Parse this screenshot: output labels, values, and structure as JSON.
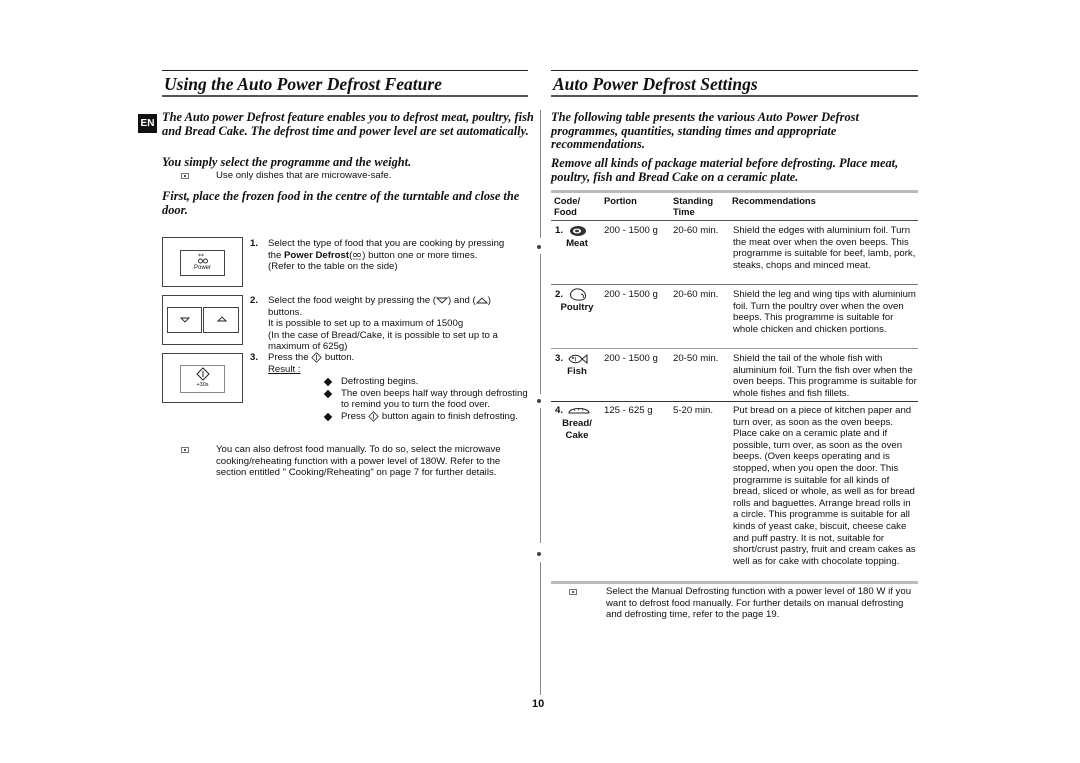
{
  "language_badge": "EN",
  "page_number": "10",
  "left": {
    "title": "Using the Auto Power Defrost Feature",
    "intro": "The Auto power Defrost feature enables you to defrost meat, poultry, fish and Bread Cake. The defrost time and power level are set automatically.",
    "subintro": "You simply select the programme and the weight.",
    "note1": "Use only dishes that are microwave-safe.",
    "first_place": "First, place the frozen food in the centre of the turntable and close the door.",
    "panels": {
      "power_label": "Power",
      "start_label": "+30s",
      "down_icon": "triangle-down-icon",
      "up_icon": "triangle-up-icon",
      "power_icon": "power-defrost-icon",
      "start_icon": "start-diamond-icon"
    },
    "steps": [
      {
        "num": "1.",
        "line1": "Select the type of food that you are cooking by pressing",
        "line2_pre": "the ",
        "line2_bold": "Power Defrost",
        "line2_post": ") button one or more times.",
        "line3": "(Refer to the table on the side)"
      },
      {
        "num": "2.",
        "line1_pre": "Select the food weight by pressing the (",
        "line1_mid": ") and (",
        "line1_post": ")",
        "line2": "buttons.",
        "line3": "It is possible to set up to a maximum of 1500g",
        "line4": "(In the case of Bread/Cake, it is possible to set up to a",
        "line5": "maximum of 625g)"
      },
      {
        "num": "3.",
        "line1_pre": "Press the",
        "line1_post": "button.",
        "result_label": "Result :",
        "bullets": [
          "Defrosting begins.",
          "The oven beeps half way through defrosting to remind you to turn the food over.",
          "button again to finish defrosting."
        ],
        "bullet3_pre": "Press"
      }
    ],
    "note2": "You can also defrost food manually. To do so, select the microwave cooking/reheating function with a power level of 180W. Refer to the section entitled \" Cooking/Reheating\" on page 7 for further details."
  },
  "right": {
    "title": "Auto Power Defrost Settings",
    "intro": "The following table presents the various Auto Power Defrost programmes, quantities, standing times and appropriate recommendations.",
    "intro2": "Remove all kinds of package material before defrosting. Place meat, poultry, fish and Bread Cake on a ceramic plate.",
    "table": {
      "headers": [
        "Code/\nFood",
        "Portion",
        "Standing\nTime",
        "Recommendations"
      ],
      "header_code": [
        "Code/",
        "Food"
      ],
      "header_portion": "Portion",
      "header_standing": [
        "Standing",
        "Time"
      ],
      "header_recommendations": "Recommendations",
      "rows": [
        {
          "code": "1.",
          "food": "Meat",
          "icon": "meat-icon",
          "portion": "200 - 1500 g",
          "standing": "20-60 min.",
          "recommendation": "Shield the edges with aluminium foil. Turn the meat over when the oven beeps. This programme is suitable for beef, lamb, pork, steaks, chops and minced meat."
        },
        {
          "code": "2.",
          "food": "Poultry",
          "icon": "poultry-icon",
          "portion": "200 - 1500 g",
          "standing": "20-60 min.",
          "recommendation": "Shield the leg and wing tips with aluminium foil. Turn the poultry over when the oven beeps. This programme is suitable for whole chicken and chicken portions."
        },
        {
          "code": "3.",
          "food": "Fish",
          "icon": "fish-icon",
          "portion": "200 - 1500 g",
          "standing": "20-50 min.",
          "recommendation": "Shield the tail of the whole fish with aluminium foil. Turn the fish over when the oven beeps. This programme is suitable for whole fishes and fish fillets."
        },
        {
          "code": "4.",
          "food": "Bread/\nCake",
          "food_lines": [
            "Bread/",
            "Cake"
          ],
          "icon": "bread-icon",
          "portion": "125 - 625 g",
          "standing": "5-20 min.",
          "recommendation": "Put bread on a piece of kitchen paper and turn over, as soon as the oven beeps. Place cake on a ceramic plate and if possible, turn over, as soon as the oven beeps. (Oven keeps operating and is stopped, when you open the door. This programme is suitable for all kinds of bread, sliced or whole, as well as for bread rolls and baguettes. Arrange bread rolls in a circle. This programme is suitable for all kinds of yeast cake, biscuit, cheese cake and puff pastry. It is not, suitable for short/crust pastry, fruit and cream cakes as well as for cake with chocolate topping."
        }
      ]
    },
    "note": "Select the Manual Defrosting function with a power level of 180 W if you want to defrost food manually. For further details on manual defrosting and defrosting time, refer to the page 19."
  }
}
